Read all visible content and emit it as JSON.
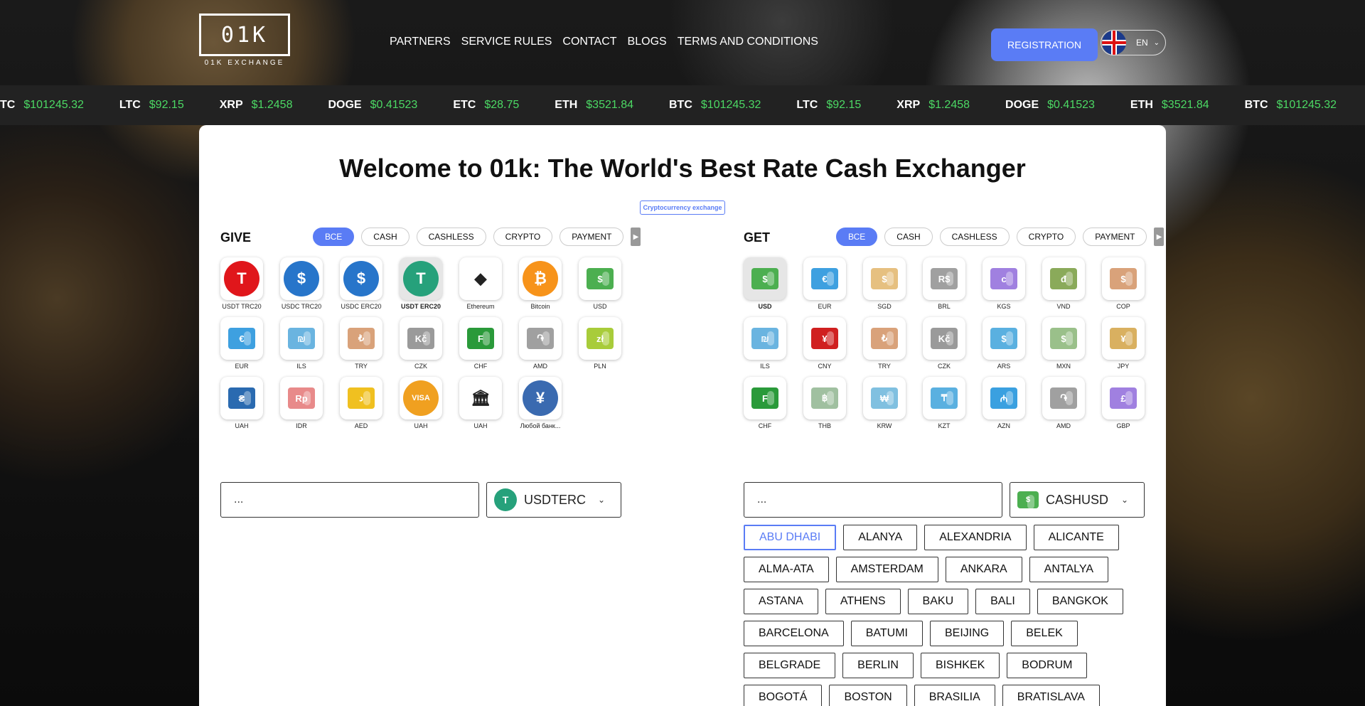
{
  "logo": {
    "text": "01K",
    "subtitle": "01K EXCHANGE"
  },
  "nav": [
    "PARTNERS",
    "SERVICE RULES",
    "CONTACT",
    "BLOGS",
    "TERMS AND CONDITIONS"
  ],
  "registration_label": "REGISTRATION",
  "language": "EN",
  "ticker": [
    {
      "symbol": "TC",
      "price": "$101245.32"
    },
    {
      "symbol": "LTC",
      "price": "$92.15"
    },
    {
      "symbol": "XRP",
      "price": "$1.2458"
    },
    {
      "symbol": "DOGE",
      "price": "$0.41523"
    },
    {
      "symbol": "ETC",
      "price": "$28.75"
    },
    {
      "symbol": "ETH",
      "price": "$3521.84"
    },
    {
      "symbol": "BTC",
      "price": "$101245.32"
    },
    {
      "symbol": "LTC",
      "price": "$92.15"
    },
    {
      "symbol": "XRP",
      "price": "$1.2458"
    },
    {
      "symbol": "DOGE",
      "price": "$0.41523"
    },
    {
      "symbol": "ETH",
      "price": "$3521.84"
    },
    {
      "symbol": "BTC",
      "price": "$101245.32"
    }
  ],
  "heading": "Welcome to 01k: The World's Best Rate Cash Exchanger",
  "crypto_tag": "Cryptocurrency exchange",
  "tabs": [
    "ВСЕ",
    "CASH",
    "CASHLESS",
    "CRYPTO",
    "PAYMENT"
  ],
  "give": {
    "title": "GIVE",
    "items": [
      {
        "label": "USDT TRC20",
        "icon": "usdt-trc20-icon",
        "kind": "coin",
        "color": "#e0161b",
        "glyph": "T"
      },
      {
        "label": "USDC TRC20",
        "icon": "usdc-trc20-icon",
        "kind": "coin",
        "color": "#2775ca",
        "glyph": "$"
      },
      {
        "label": "USDC ERC20",
        "icon": "usdc-erc20-icon",
        "kind": "coin",
        "color": "#2775ca",
        "glyph": "$"
      },
      {
        "label": "USDT ERC20",
        "icon": "usdt-erc20-icon",
        "kind": "coin",
        "color": "#26a17b",
        "glyph": "T",
        "selected": true
      },
      {
        "label": "Ethereum",
        "icon": "ethereum-icon",
        "kind": "coin",
        "color": "#ffffff",
        "glyph": "◆",
        "dark": true
      },
      {
        "label": "Bitcoin",
        "icon": "bitcoin-icon",
        "kind": "coin",
        "color": "#f7931a",
        "glyph": "₿"
      },
      {
        "label": "USD",
        "icon": "usd-cash-icon",
        "kind": "cash",
        "color": "#4caf50",
        "glyph": "$"
      },
      {
        "label": "EUR",
        "icon": "eur-cash-icon",
        "kind": "cash",
        "color": "#3ea0e0",
        "glyph": "€"
      },
      {
        "label": "ILS",
        "icon": "ils-cash-icon",
        "kind": "cash",
        "color": "#6ab4e0",
        "glyph": "₪"
      },
      {
        "label": "TRY",
        "icon": "try-cash-icon",
        "kind": "cash",
        "color": "#d9a27a",
        "glyph": "₺"
      },
      {
        "label": "CZK",
        "icon": "czk-cash-icon",
        "kind": "cash",
        "color": "#9a9a9a",
        "glyph": "Kč"
      },
      {
        "label": "CHF",
        "icon": "chf-cash-icon",
        "kind": "cash",
        "color": "#2a9a3a",
        "glyph": "F"
      },
      {
        "label": "AMD",
        "icon": "amd-cash-icon",
        "kind": "cash",
        "color": "#a0a0a0",
        "glyph": "֏"
      },
      {
        "label": "PLN",
        "icon": "pln-cash-icon",
        "kind": "cash",
        "color": "#a8cc3a",
        "glyph": "zł"
      },
      {
        "label": "UAH",
        "icon": "uah-cash-icon",
        "kind": "cash",
        "color": "#2a6ab0",
        "glyph": "₴"
      },
      {
        "label": "IDR",
        "icon": "idr-cash-icon",
        "kind": "cash",
        "color": "#e88a8a",
        "glyph": "Rp"
      },
      {
        "label": "AED",
        "icon": "aed-cash-icon",
        "kind": "cash",
        "color": "#f0c020",
        "glyph": "د"
      },
      {
        "label": "UAH",
        "icon": "visa-mastercard-icon",
        "kind": "coin",
        "color": "#f0a020",
        "glyph": "VISA"
      },
      {
        "label": "UAH",
        "icon": "bank-icon",
        "kind": "coin",
        "color": "#ffffff",
        "glyph": "🏛",
        "dark": true
      },
      {
        "label": "Любой банк...",
        "icon": "yuan-coin-icon",
        "kind": "coin",
        "color": "#3a6ab0",
        "glyph": "¥"
      }
    ]
  },
  "get": {
    "title": "GET",
    "items": [
      {
        "label": "USD",
        "icon": "usd-cash-icon",
        "kind": "cash",
        "color": "#4caf50",
        "glyph": "$",
        "selected": true
      },
      {
        "label": "EUR",
        "icon": "eur-cash-icon",
        "kind": "cash",
        "color": "#3ea0e0",
        "glyph": "€"
      },
      {
        "label": "SGD",
        "icon": "sgd-cash-icon",
        "kind": "cash",
        "color": "#e6c080",
        "glyph": "$"
      },
      {
        "label": "BRL",
        "icon": "brl-cash-icon",
        "kind": "cash",
        "color": "#a0a0a0",
        "glyph": "R$"
      },
      {
        "label": "KGS",
        "icon": "kgs-cash-icon",
        "kind": "cash",
        "color": "#a080e0",
        "glyph": "с"
      },
      {
        "label": "VND",
        "icon": "vnd-cash-icon",
        "kind": "cash",
        "color": "#8aaa5a",
        "glyph": "đ"
      },
      {
        "label": "COP",
        "icon": "cop-cash-icon",
        "kind": "cash",
        "color": "#d9a27a",
        "glyph": "$"
      },
      {
        "label": "ILS",
        "icon": "ils-cash-icon",
        "kind": "cash",
        "color": "#6ab4e0",
        "glyph": "₪"
      },
      {
        "label": "CNY",
        "icon": "cny-cash-icon",
        "kind": "cash",
        "color": "#d02020",
        "glyph": "¥"
      },
      {
        "label": "TRY",
        "icon": "try-cash-icon",
        "kind": "cash",
        "color": "#d9a27a",
        "glyph": "₺"
      },
      {
        "label": "CZK",
        "icon": "czk-cash-icon",
        "kind": "cash",
        "color": "#9a9a9a",
        "glyph": "Kč"
      },
      {
        "label": "ARS",
        "icon": "ars-cash-icon",
        "kind": "cash",
        "color": "#5ab0e0",
        "glyph": "$"
      },
      {
        "label": "MXN",
        "icon": "mxn-cash-icon",
        "kind": "cash",
        "color": "#9ac08a",
        "glyph": "$"
      },
      {
        "label": "JPY",
        "icon": "jpy-cash-icon",
        "kind": "cash",
        "color": "#d9b060",
        "glyph": "¥"
      },
      {
        "label": "CHF",
        "icon": "chf-cash-icon",
        "kind": "cash",
        "color": "#2a9a3a",
        "glyph": "F"
      },
      {
        "label": "THB",
        "icon": "thb-cash-icon",
        "kind": "cash",
        "color": "#a0c0a0",
        "glyph": "฿"
      },
      {
        "label": "KRW",
        "icon": "krw-cash-icon",
        "kind": "cash",
        "color": "#80c0e0",
        "glyph": "₩"
      },
      {
        "label": "KZT",
        "icon": "kzt-cash-icon",
        "kind": "cash",
        "color": "#5ab0e0",
        "glyph": "₸"
      },
      {
        "label": "AZN",
        "icon": "azn-cash-icon",
        "kind": "cash",
        "color": "#3aa0e0",
        "glyph": "₼"
      },
      {
        "label": "AMD",
        "icon": "amd-cash-icon",
        "kind": "cash",
        "color": "#a0a0a0",
        "glyph": "֏"
      },
      {
        "label": "GBP",
        "icon": "gbp-cash-icon",
        "kind": "cash",
        "color": "#a080e0",
        "glyph": "£"
      }
    ]
  },
  "give_input": {
    "placeholder": "...",
    "currency": "USDTERC"
  },
  "get_input": {
    "placeholder": "...",
    "currency": "CASHUSD"
  },
  "cities": [
    "ABU DHABI",
    "ALANYA",
    "ALEXANDRIA",
    "ALICANTE",
    "ALMA-ATA",
    "AMSTERDAM",
    "ANKARA",
    "ANTALYA",
    "ASTANA",
    "ATHENS",
    "BAKU",
    "BALI",
    "BANGKOK",
    "BARCELONA",
    "BATUMI",
    "BEIJING",
    "BELEK",
    "BELGRADE",
    "BERLIN",
    "BISHKEK",
    "BODRUM",
    "BOGOTÁ",
    "BOSTON",
    "BRASILIA",
    "BRATISLAVA"
  ],
  "active_city": "ABU DHABI"
}
